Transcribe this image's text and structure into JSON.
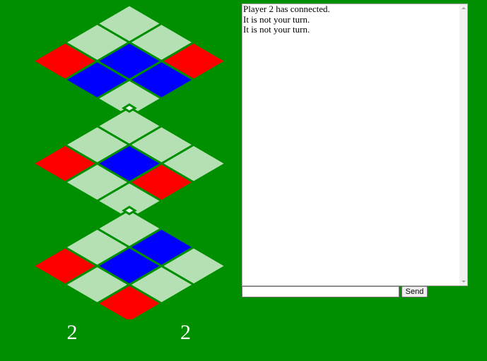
{
  "colors": {
    "background": "#008f00",
    "empty_cell": "#b4e0b4",
    "blue": "#0000ff",
    "red": "#ff0000",
    "link_marker": "#e6f6e6"
  },
  "board": {
    "layers": [
      {
        "rows": [
          [
            "empty",
            "empty",
            "red"
          ],
          [
            "empty",
            "blue",
            "blue"
          ],
          [
            "red",
            "blue",
            "empty"
          ]
        ]
      },
      {
        "rows": [
          [
            "empty",
            "empty",
            "empty"
          ],
          [
            "empty",
            "blue",
            "red"
          ],
          [
            "red",
            "empty",
            "empty"
          ]
        ]
      },
      {
        "rows": [
          [
            "empty",
            "blue",
            "empty"
          ],
          [
            "empty",
            "blue",
            "empty"
          ],
          [
            "red",
            "empty",
            "red"
          ]
        ]
      }
    ]
  },
  "score": {
    "blue": "2",
    "red": "2"
  },
  "chat": {
    "messages": [
      "Player 2 has connected.",
      "It is not your turn.",
      "It is not your turn."
    ],
    "input_value": "",
    "send_label": "Send"
  }
}
